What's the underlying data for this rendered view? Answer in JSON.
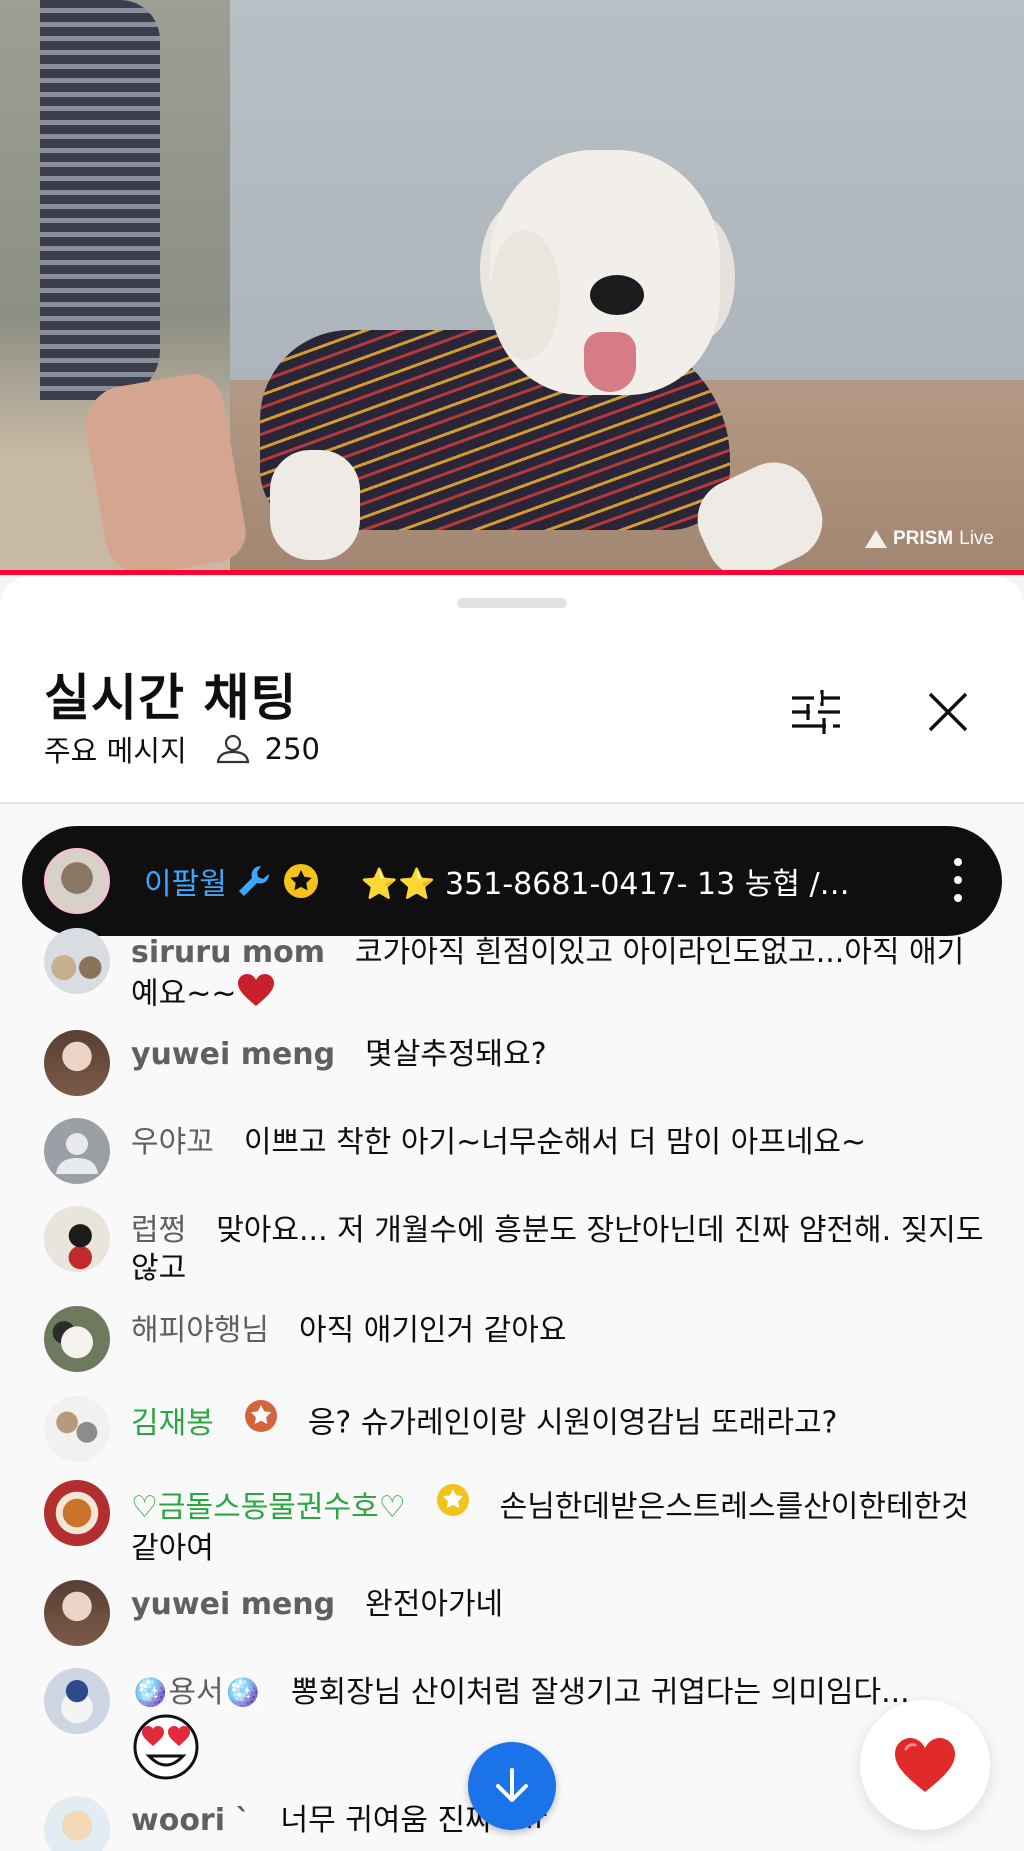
{
  "video": {
    "watermark_brand": "PRISM",
    "watermark_suffix": "Live",
    "progress_fraction": 1.0
  },
  "chat": {
    "title": "실시간 채팅",
    "mode_label": "주요 메시지",
    "viewer_count": "250",
    "pinned": {
      "author": "이팔월",
      "text": "⭐⭐ 351-8681-0417- 13 농협 /…"
    },
    "messages": [
      {
        "author": "siruru mom",
        "text": "코가아직 흰점이있고 아이라인도없고...아직 애기예요~~"
      },
      {
        "author": "yuwei meng",
        "text": "몇살추정돼요?"
      },
      {
        "author": "우야꼬",
        "text": "이쁘고 착한 아기~너무순해서 더 맘이 아프네요~"
      },
      {
        "author": "럽쩡",
        "text": "맞아요... 저 개월수에 흥분도 장난아닌데 진짜 얌전해. 짖지도 않고"
      },
      {
        "author": "해피야행님",
        "text": "아직 애기인거 같아요"
      },
      {
        "author": "김재봉",
        "text": "응? 슈가레인이랑 시원이영감님 또래라고?"
      },
      {
        "author": "♡금돌스동물권수호♡",
        "text": "손님한데받은스트레스를산이한테한것같아여"
      },
      {
        "author": "yuwei meng",
        "text": "완전아가네"
      },
      {
        "author": "용서",
        "text": "뽕회장님 산이처럼 잘생기고 귀엽다는 의미임다..."
      },
      {
        "author": "woori `",
        "text": "너무 귀여움 진짜ㅠㅠ"
      }
    ]
  },
  "colors": {
    "accent_blue": "#1a73e8",
    "owner_name_blue": "#3ea6ff",
    "member_green": "#2ba640",
    "progress_red": "#ff0033"
  },
  "icons": [
    "prism-logo-icon",
    "filter-icon",
    "close-icon",
    "person-icon",
    "wrench-icon",
    "star-badge-icon",
    "more-vert-icon",
    "heart-icon",
    "arrow-down-icon"
  ]
}
